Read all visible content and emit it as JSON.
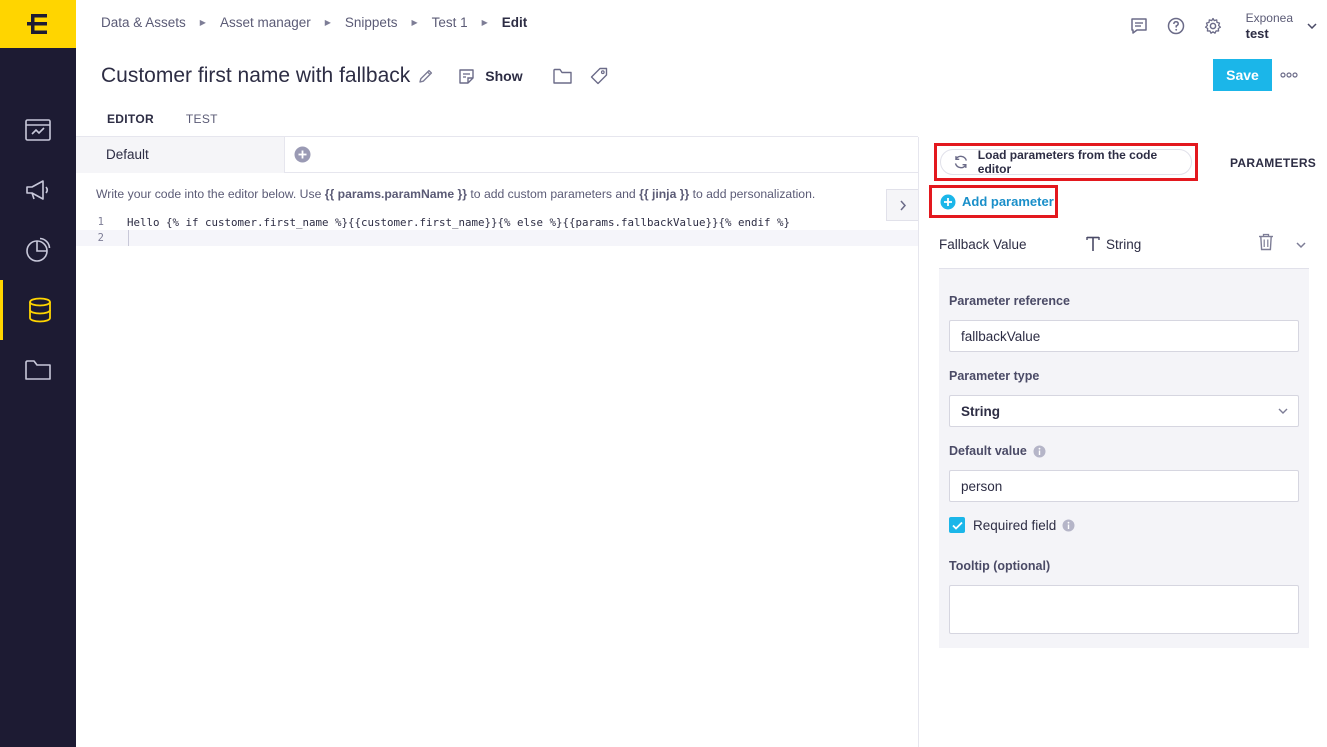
{
  "breadcrumbs": [
    "Data & Assets",
    "Asset manager",
    "Snippets",
    "Test 1"
  ],
  "breadcrumb_current": "Edit",
  "account": {
    "company": "Exponea",
    "project": "test"
  },
  "title": "Customer first name with fallback",
  "toolbar": {
    "show_label": "Show",
    "save_label": "Save"
  },
  "tabs": [
    {
      "label": "EDITOR",
      "active": true
    },
    {
      "label": "TEST",
      "active": false
    }
  ],
  "editor": {
    "snippet_tab": "Default",
    "hint": {
      "part1": "Write your code into the editor below. Use ",
      "params_code": "{{ params.paramName }}",
      "part2": " to add custom parameters and ",
      "jinja_code": "{{ jinja }}",
      "part3": " to add personalization."
    },
    "lines": [
      {
        "number": "1",
        "code": "Hello {% if customer.first_name %}{{customer.first_name}}{% else %}{{params.fallbackValue}}{% endif %}"
      },
      {
        "number": "2",
        "code": ""
      }
    ]
  },
  "parameters_panel": {
    "load_button": "Load parameters from the code editor",
    "section_label": "PARAMETERS",
    "add_button": "Add parameter",
    "parameter": {
      "name": "Fallback Value",
      "type_label": "String",
      "reference_label": "Parameter reference",
      "reference_value": "fallbackValue",
      "type_field_label": "Parameter type",
      "type_value": "String",
      "default_label": "Default value",
      "default_value": "person",
      "required_label": "Required field",
      "required_checked": true,
      "tooltip_label": "Tooltip (optional)",
      "tooltip_value": ""
    }
  },
  "colors": {
    "sidebar": "#1d1b33",
    "brand_yellow": "#ffd500",
    "accent_blue": "#1bb6e9",
    "highlight_red": "#e3181e"
  },
  "icons": {
    "sidebar": [
      "dashboard-icon",
      "campaign-megaphone-icon",
      "analytics-pie-icon",
      "database-icon",
      "folder-icon"
    ],
    "topbar": [
      "chat-icon",
      "help-icon",
      "settings-gear-icon",
      "chevron-down-icon"
    ]
  }
}
